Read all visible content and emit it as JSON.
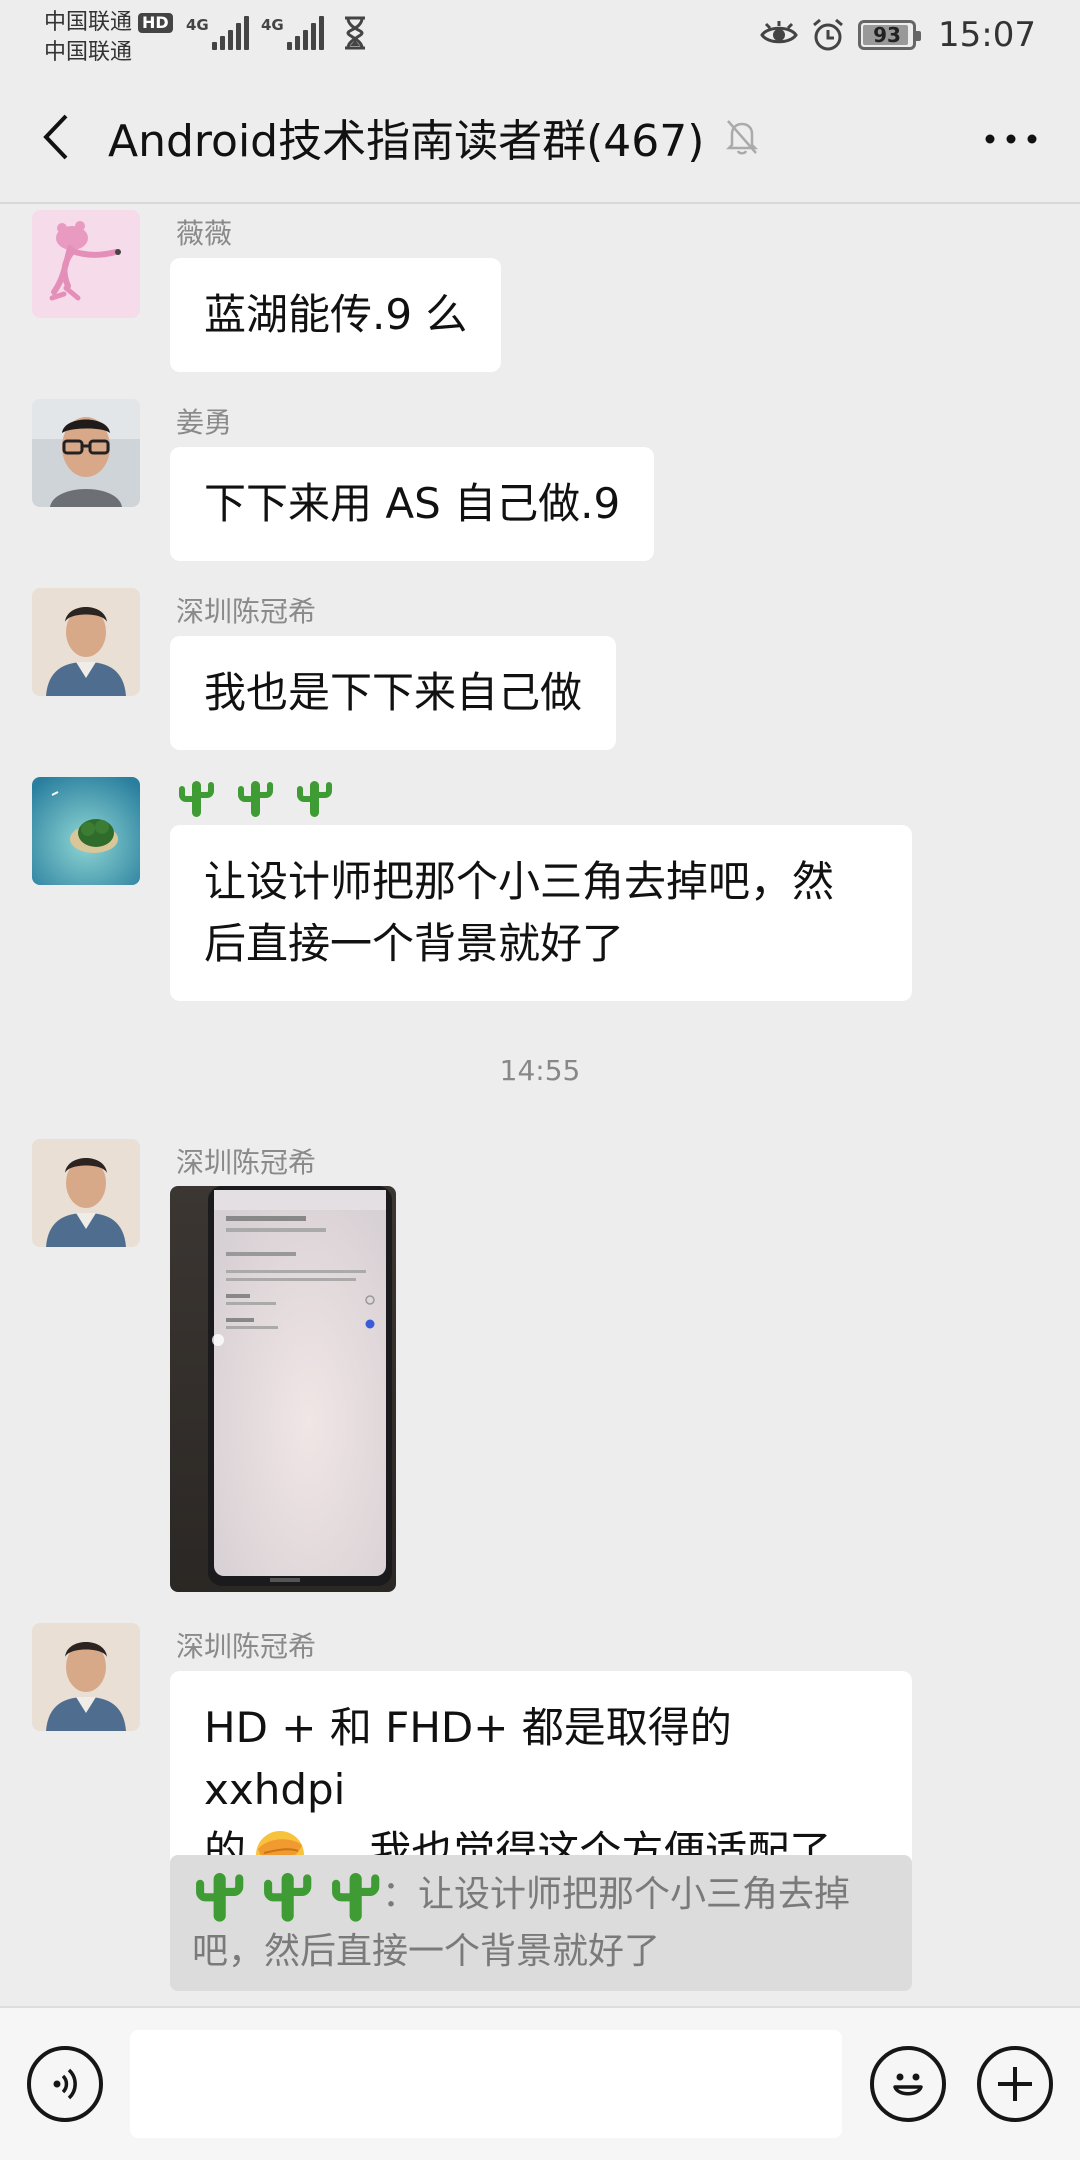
{
  "status_bar": {
    "carrier_1": "中国联通",
    "hd_badge": "HD",
    "carrier_2": "中国联通",
    "network_1": "4G",
    "network_2": "4G",
    "battery_level": 93,
    "battery_text": "93",
    "time": "15:07",
    "icons": [
      "hourglass-icon",
      "eye-icon",
      "alarm-icon",
      "battery-icon"
    ]
  },
  "nav": {
    "back_icon": "chevron-left-icon",
    "title": "Android技术指南读者群(467)",
    "mute_icon": "bell-off-icon",
    "more_icon": "more-dots-icon"
  },
  "messages": [
    {
      "sender": "薇薇",
      "text": "蓝湖能传.9 么",
      "avatar": "pink-panther"
    },
    {
      "sender": "姜勇",
      "text": "下下来用 AS 自己做.9",
      "avatar": "man-glasses"
    },
    {
      "sender": "深圳陈冠希",
      "text": "我也是下下来自己做",
      "avatar": "man-denim"
    },
    {
      "sender_emoji": "cactus x3",
      "line1": "让设计师把那个小三角去掉吧，然",
      "line2": "后直接一个背景就好了",
      "avatar": "island"
    },
    {
      "sender": "深圳陈冠希",
      "type": "image",
      "avatar": "man-denim"
    },
    {
      "sender": "深圳陈冠希",
      "line1": "HD + 和 FHD+ 都是取得的 xxhdpi",
      "line2_before": "的",
      "line2_after": " 。我也觉得这个方便适配了",
      "avatar": "man-denim"
    }
  ],
  "time_divider": "14:55",
  "quote": {
    "line1": "：让设计师把那个小三角去掉",
    "line2": "吧，然后直接一个背景就好了"
  },
  "input_bar": {
    "voice_icon": "voice-icon",
    "input_value": "",
    "emoji_icon": "smiley-icon",
    "plus_icon": "plus-icon"
  }
}
